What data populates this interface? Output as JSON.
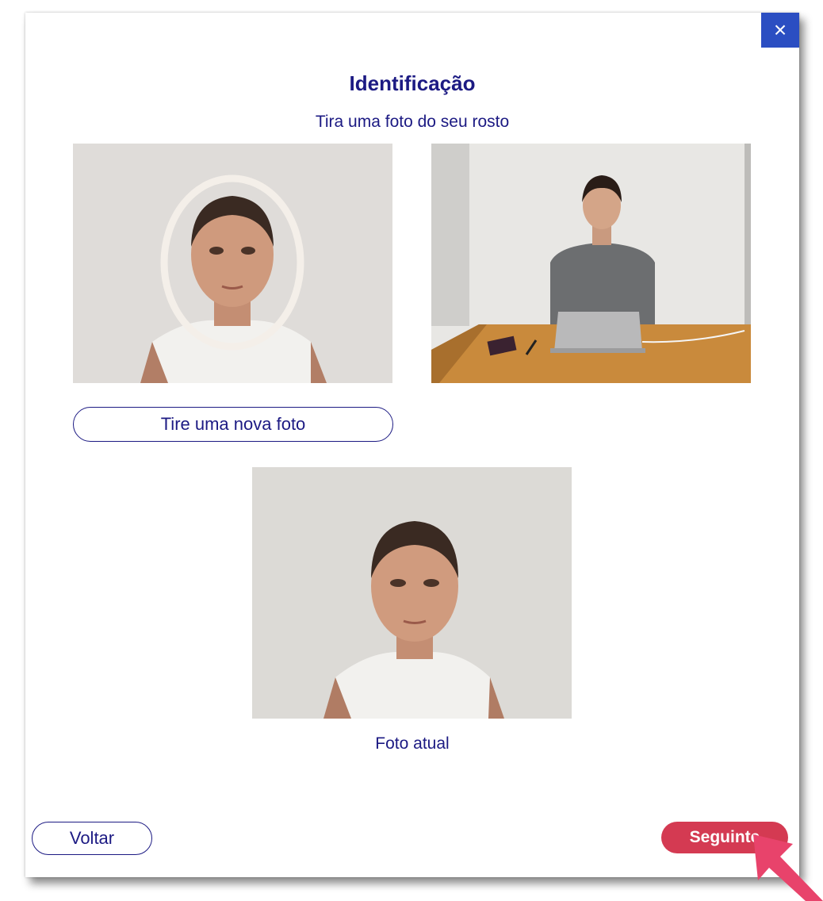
{
  "dialog": {
    "close_symbol": "×",
    "title": "Identificação",
    "subtitle": "Tira uma foto do seu rosto",
    "retake_button": "Tire uma nova foto",
    "current_photo_caption": "Foto atual",
    "back_button": "Voltar",
    "next_button": "Seguinte"
  },
  "colors": {
    "title_text": "#1c1a83",
    "close_button": "#2b4ec2",
    "next_button": "#d43a52",
    "pointer_arrow": "#e8436b"
  },
  "icons": {
    "close": "close-icon",
    "pointer": "arrow-pointer-icon"
  }
}
